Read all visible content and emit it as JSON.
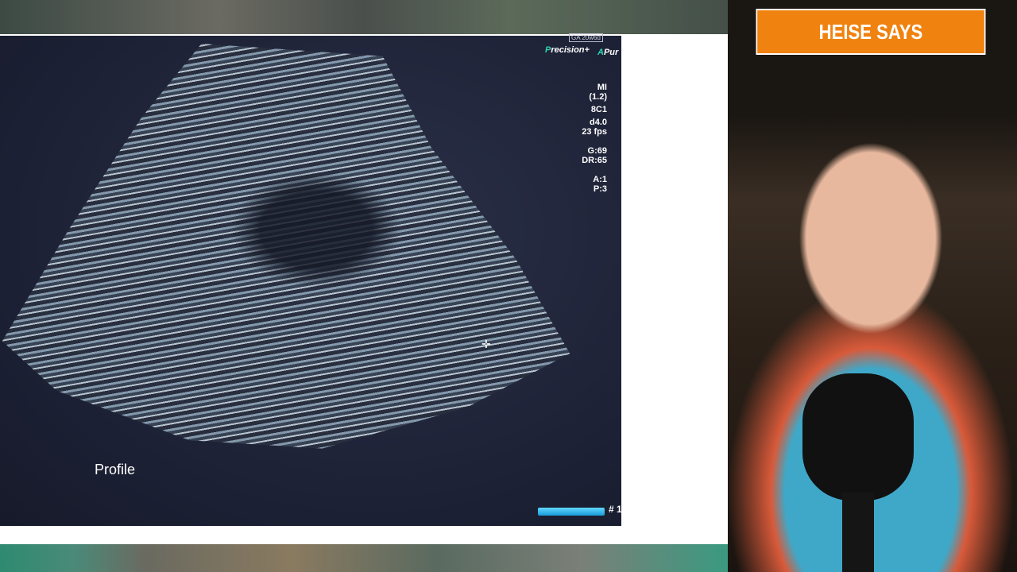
{
  "overlay": {
    "banner": "HEISE SAYS"
  },
  "ultrasound": {
    "label": "Profile",
    "ga": "GA 20w6d",
    "mode1": {
      "icon": "P",
      "text": "recision+"
    },
    "mode2": {
      "icon": "A",
      "text": "Pur"
    },
    "readout": [
      "MI",
      "(1.2)",
      "8C1",
      "d4.0",
      "23 fps",
      "G:69",
      "DR:65",
      "A:1",
      "P:3"
    ],
    "scale_marker": "# 1"
  }
}
